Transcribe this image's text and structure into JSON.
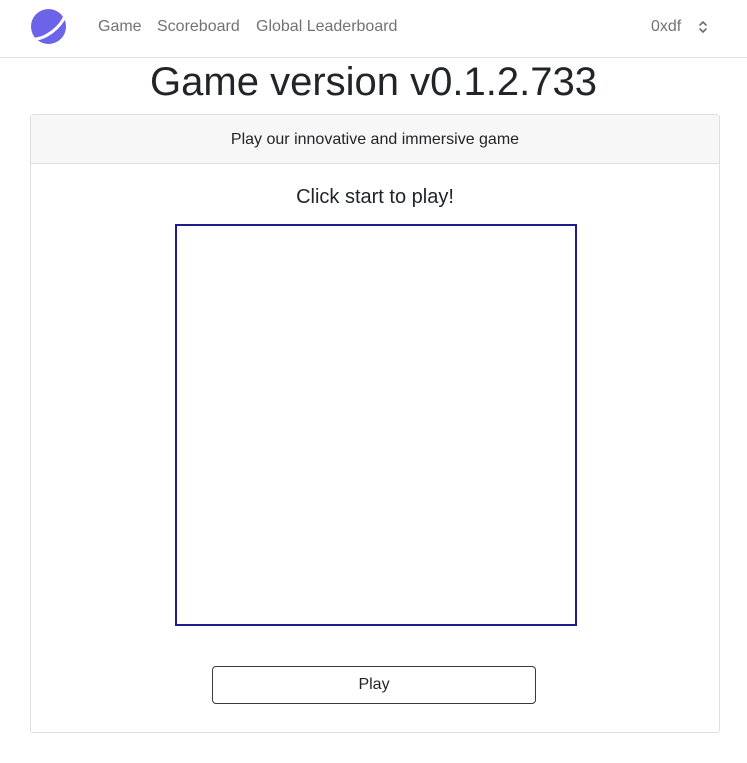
{
  "nav": {
    "logo_icon": "planet-logo-icon",
    "links": [
      "Game",
      "Scoreboard",
      "Global Leaderboard"
    ],
    "user": "0xdf",
    "user_menu_icon": "chevron-up-down-icon"
  },
  "page": {
    "title": "Game version v0.1.2.733"
  },
  "card": {
    "header": "Play our innovative and immersive game",
    "prompt": "Click start to play!",
    "play_label": "Play"
  },
  "colors": {
    "logo": "#6b63e8",
    "canvas_border": "#1f1b8f",
    "nav_text": "#727272"
  }
}
